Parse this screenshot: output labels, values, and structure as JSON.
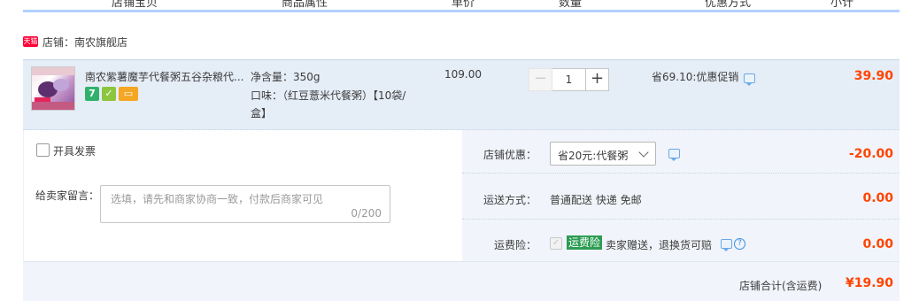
{
  "header": {
    "columns": [
      "店铺宝贝",
      "商品属性",
      "单价",
      "数量",
      "优惠方式",
      "小计"
    ]
  },
  "shop": {
    "badge": "天猫",
    "label": "店铺：",
    "name": "南农旗舰店"
  },
  "item": {
    "title": "南农紫薯魔芋代餐粥五谷杂粮代...",
    "badges": [
      "7",
      "shield",
      "card"
    ],
    "props": {
      "net_weight": "净含量：350g",
      "flavor": "口味：（红豆薏米代餐粥）【10袋/盒】"
    },
    "unit_price": "109.00",
    "quantity": {
      "minus": "−",
      "value": "1",
      "plus": "+"
    },
    "promotion": "省69.10:优惠促销",
    "subtotal": "39.90"
  },
  "invoice": {
    "label": "开具发票"
  },
  "message": {
    "label": "给卖家留言：",
    "placeholder": "选填，请先和商家协商一致，付款后商家可见",
    "counter": "0/200"
  },
  "shop_discount": {
    "label": "店铺优惠：",
    "selected": "省20元:代餐粥",
    "amount": "-20.00"
  },
  "shipping": {
    "label": "运送方式：",
    "value": "普通配送 快递 免邮",
    "amount": "0.00"
  },
  "insurance": {
    "label": "运费险：",
    "tag": "运费险",
    "desc": "卖家赠送，退换货可赔",
    "amount": "0.00"
  },
  "total": {
    "label": "店铺合计(含运费)",
    "value": "¥19.90"
  },
  "colors": {
    "price_red": "#ff4400",
    "row_bg": "#e5edf7",
    "panel_bg": "#f1f4fa",
    "insurance_green": "#2b9c52"
  }
}
